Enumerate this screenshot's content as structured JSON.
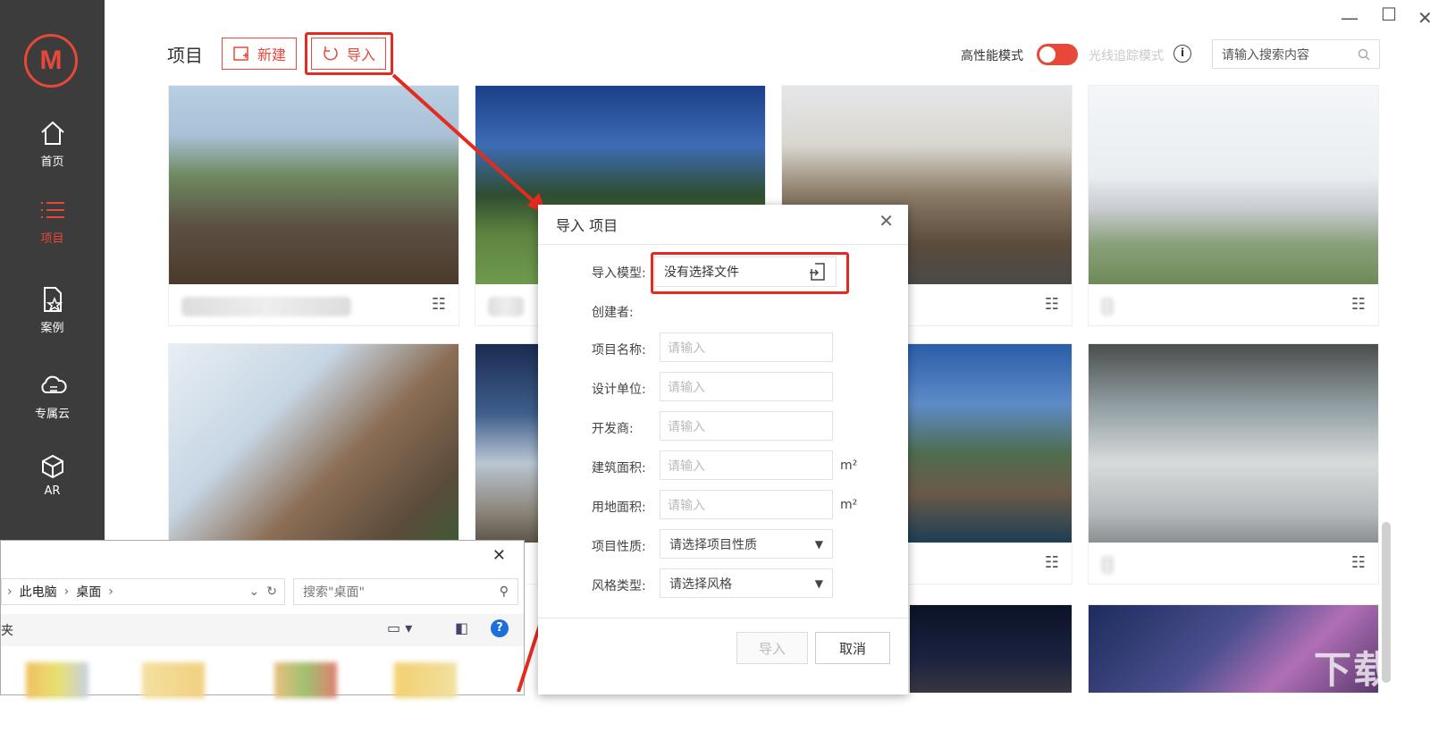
{
  "sidebar": {
    "logo": "M",
    "items": [
      {
        "label": "首页",
        "icon": "home-icon"
      },
      {
        "label": "项目",
        "icon": "list-icon"
      },
      {
        "label": "案例",
        "icon": "case-icon"
      },
      {
        "label": "专属云",
        "icon": "cloud-icon"
      },
      {
        "label": "AR",
        "icon": "ar-cube-icon"
      }
    ]
  },
  "header": {
    "title": "项目",
    "new_label": "新建",
    "import_label": "导入",
    "mode_high": "高性能模式",
    "mode_ray": "光线追踪模式",
    "search_placeholder": "请输入搜索内容"
  },
  "dialog": {
    "title": "导入 项目",
    "fields": {
      "model_label": "导入模型:",
      "model_value": "没有选择文件",
      "creator_label": "创建者:",
      "name_label": "项目名称:",
      "design_label": "设计单位:",
      "developer_label": "开发商:",
      "build_area_label": "建筑面积:",
      "land_area_label": "用地面积:",
      "nature_label": "项目性质:",
      "nature_value": "请选择项目性质",
      "style_label": "风格类型:",
      "style_value": "请选择风格",
      "placeholder": "请输入",
      "unit": "m²"
    },
    "ok_label": "导入",
    "cancel_label": "取消"
  },
  "explorer": {
    "path": [
      "此电脑",
      "桌面"
    ],
    "search_placeholder": "搜索\"桌面\"",
    "sidebar_fragment": "夹"
  },
  "watermark": "下载吧",
  "colors": {
    "accent": "#e8483a",
    "sidebar": "#3c3c3c"
  }
}
